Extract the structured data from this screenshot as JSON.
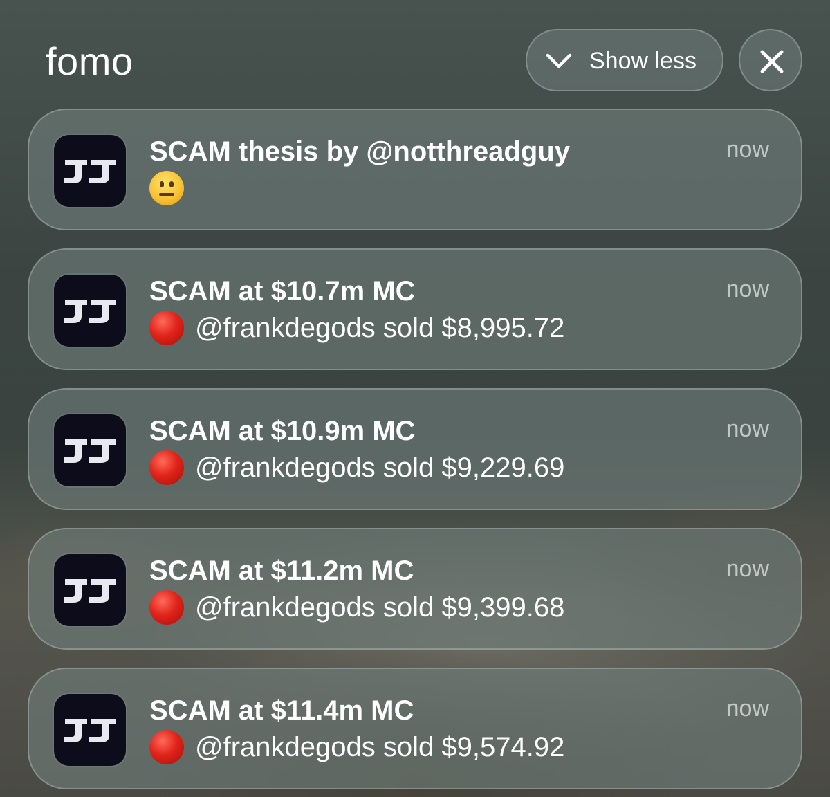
{
  "header": {
    "group_title": "fomo",
    "show_less_label": "Show less"
  },
  "notifications": [
    {
      "title": "SCAM thesis by @notthreadguy",
      "body_text": "",
      "body_emoji": "neutral-face",
      "time": "now"
    },
    {
      "title": "SCAM at $10.7m MC",
      "body_text": "@frankdegods sold $8,995.72",
      "body_emoji": "red-circle",
      "time": "now"
    },
    {
      "title": "SCAM at $10.9m MC",
      "body_text": "@frankdegods sold $9,229.69",
      "body_emoji": "red-circle",
      "time": "now"
    },
    {
      "title": "SCAM at $11.2m MC",
      "body_text": "@frankdegods sold $9,399.68",
      "body_emoji": "red-circle",
      "time": "now"
    },
    {
      "title": "SCAM at $11.4m MC",
      "body_text": "@frankdegods sold $9,574.92",
      "body_emoji": "red-circle",
      "time": "now"
    }
  ],
  "colors": {
    "icon_background": "#0d0c1a",
    "sell_indicator": "#e0241a"
  },
  "icons": {
    "app_icon": "fomo-logo-icon",
    "show_less": "chevron-down-icon",
    "close": "close-icon"
  }
}
